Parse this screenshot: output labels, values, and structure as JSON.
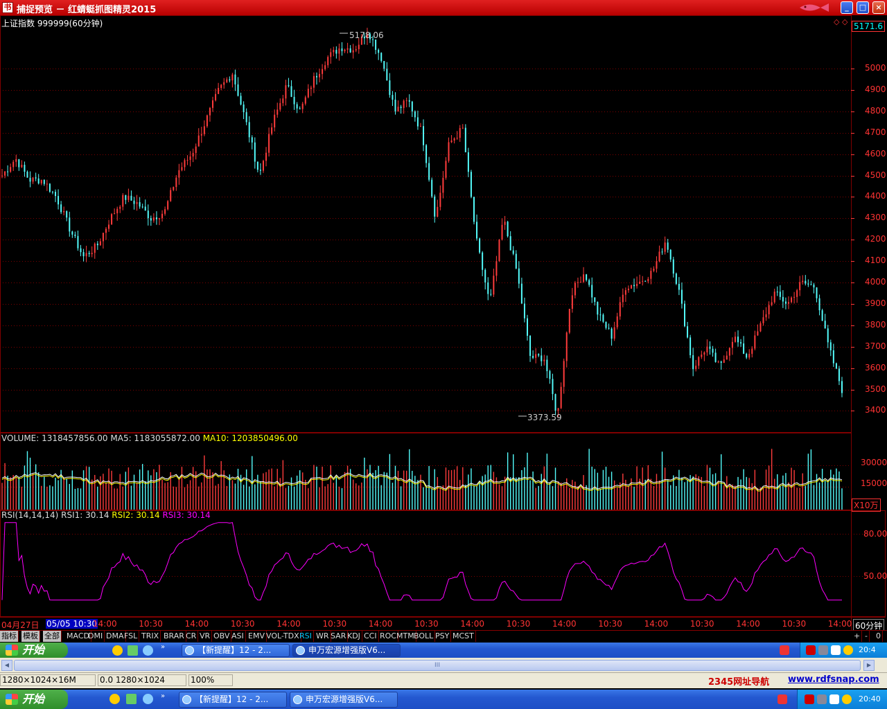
{
  "window": {
    "title": "捕捉预览 － 红蜻蜓抓图精灵2015",
    "icon_glyph": "书",
    "minimize_glyph": "_",
    "maximize_glyph": "□",
    "close_glyph": "×"
  },
  "chart_header": {
    "index_label": "上证指数 999999(60分钟)",
    "right_marker": "◇ ◇",
    "last_price": "5171.6",
    "high_label": "5178.06",
    "low_label": "3373.59"
  },
  "price_axis": [
    "5000",
    "4900",
    "4800",
    "4700",
    "4600",
    "4500",
    "4400",
    "4300",
    "4200",
    "4100",
    "4000",
    "3900",
    "3800",
    "3700",
    "3600",
    "3500",
    "3400"
  ],
  "volume_panel": {
    "volume_text": "VOLUME: 1318457856.00",
    "ma5_text": "MA5: 1183055872.00",
    "ma10_text": "MA10: 1203850496.00",
    "axis": [
      "30000",
      "15000"
    ],
    "unit": "X10万"
  },
  "rsi_panel": {
    "title_text": "RSI(14,14,14)",
    "rsi1_text": "RSI1: 30.14",
    "rsi2_text": "RSI2: 30.14",
    "rsi3_text": "RSI3: 30.14",
    "axis": [
      "80.00",
      "50.00"
    ]
  },
  "time_axis": {
    "start_date": "04月27日",
    "cursor": "05/05 10:30",
    "ticks": [
      "14:00",
      "10:30",
      "14:00",
      "10:30",
      "14:00",
      "10:30",
      "14:00",
      "10:30",
      "14:00",
      "10:30",
      "14:00",
      "10:30",
      "14:00",
      "10:30",
      "14:00",
      "10:30",
      "14:00"
    ],
    "period": "60分钟"
  },
  "tabs": {
    "categories": [
      "指标",
      "模板",
      "全部"
    ],
    "indicators": [
      "MACD",
      "DMI",
      "DMA",
      "FSL",
      "TRIX",
      "BRAR",
      "CR",
      "VR",
      "OBV",
      "ASI",
      "EMV",
      "VOL-TDX",
      "RSI",
      "WR",
      "SAR",
      "KDJ",
      "CCI",
      "ROC",
      "MTM",
      "BOLL",
      "PSY",
      "MCST"
    ],
    "active": "RSI",
    "controls": [
      "+",
      "-",
      "0"
    ]
  },
  "captured_taskbar": {
    "start_label": "开始",
    "task1": "【新提醒】12 - 2...",
    "task2": "申万宏源增强版V6...",
    "clock": "20:4"
  },
  "status": {
    "scroll_grip": "III",
    "screen_info": "1280×1024×16M",
    "coords": "0.0 1280×1024",
    "zoom": "100%",
    "nav_link": "2345网址导航",
    "site_link": "www.rdfsnap.com"
  },
  "taskbar": {
    "start_label": "开始",
    "task1": "【新提醒】12 - 2...",
    "task2": "申万宏源增强版V6...",
    "clock": "20:40"
  },
  "colors": {
    "up": "#ff3c3c",
    "down": "#54fcfc",
    "ma10": "#ffff00",
    "rsi": "#ff00ff",
    "grid": "#800000",
    "axis_text": "#ff3c3c"
  },
  "chart_data": [
    {
      "type": "candlestick",
      "title": "上证指数 999999(60分钟)",
      "ylim": [
        3330,
        5250
      ],
      "keypoints_close": [
        4500,
        4580,
        4480,
        4480,
        4400,
        4250,
        4120,
        4170,
        4300,
        4400,
        4370,
        4300,
        4330,
        4520,
        4600,
        4750,
        4900,
        4980,
        4750,
        4500,
        4750,
        4920,
        4800,
        4950,
        5050,
        5100,
        5090,
        5178,
        5050,
        4800,
        4850,
        4700,
        4300,
        4650,
        4720,
        4200,
        3900,
        4300,
        4050,
        3650,
        3650,
        3373,
        3950,
        4050,
        3850,
        3750,
        3980,
        4000,
        4050,
        4200,
        3950,
        3600,
        3700,
        3600,
        3750,
        3650,
        3800,
        3950,
        3900,
        4000,
        3980,
        3700,
        3500
      ]
    },
    {
      "type": "bar",
      "title": "VOLUME",
      "series": [
        {
          "name": "VOLUME"
        },
        {
          "name": "MA5"
        },
        {
          "name": "MA10"
        }
      ],
      "ylim": [
        0,
        42000
      ]
    },
    {
      "type": "line",
      "title": "RSI(14,14,14)",
      "series": [
        {
          "name": "RSI1"
        },
        {
          "name": "RSI2"
        },
        {
          "name": "RSI3"
        }
      ],
      "ylim": [
        30,
        90
      ]
    }
  ]
}
